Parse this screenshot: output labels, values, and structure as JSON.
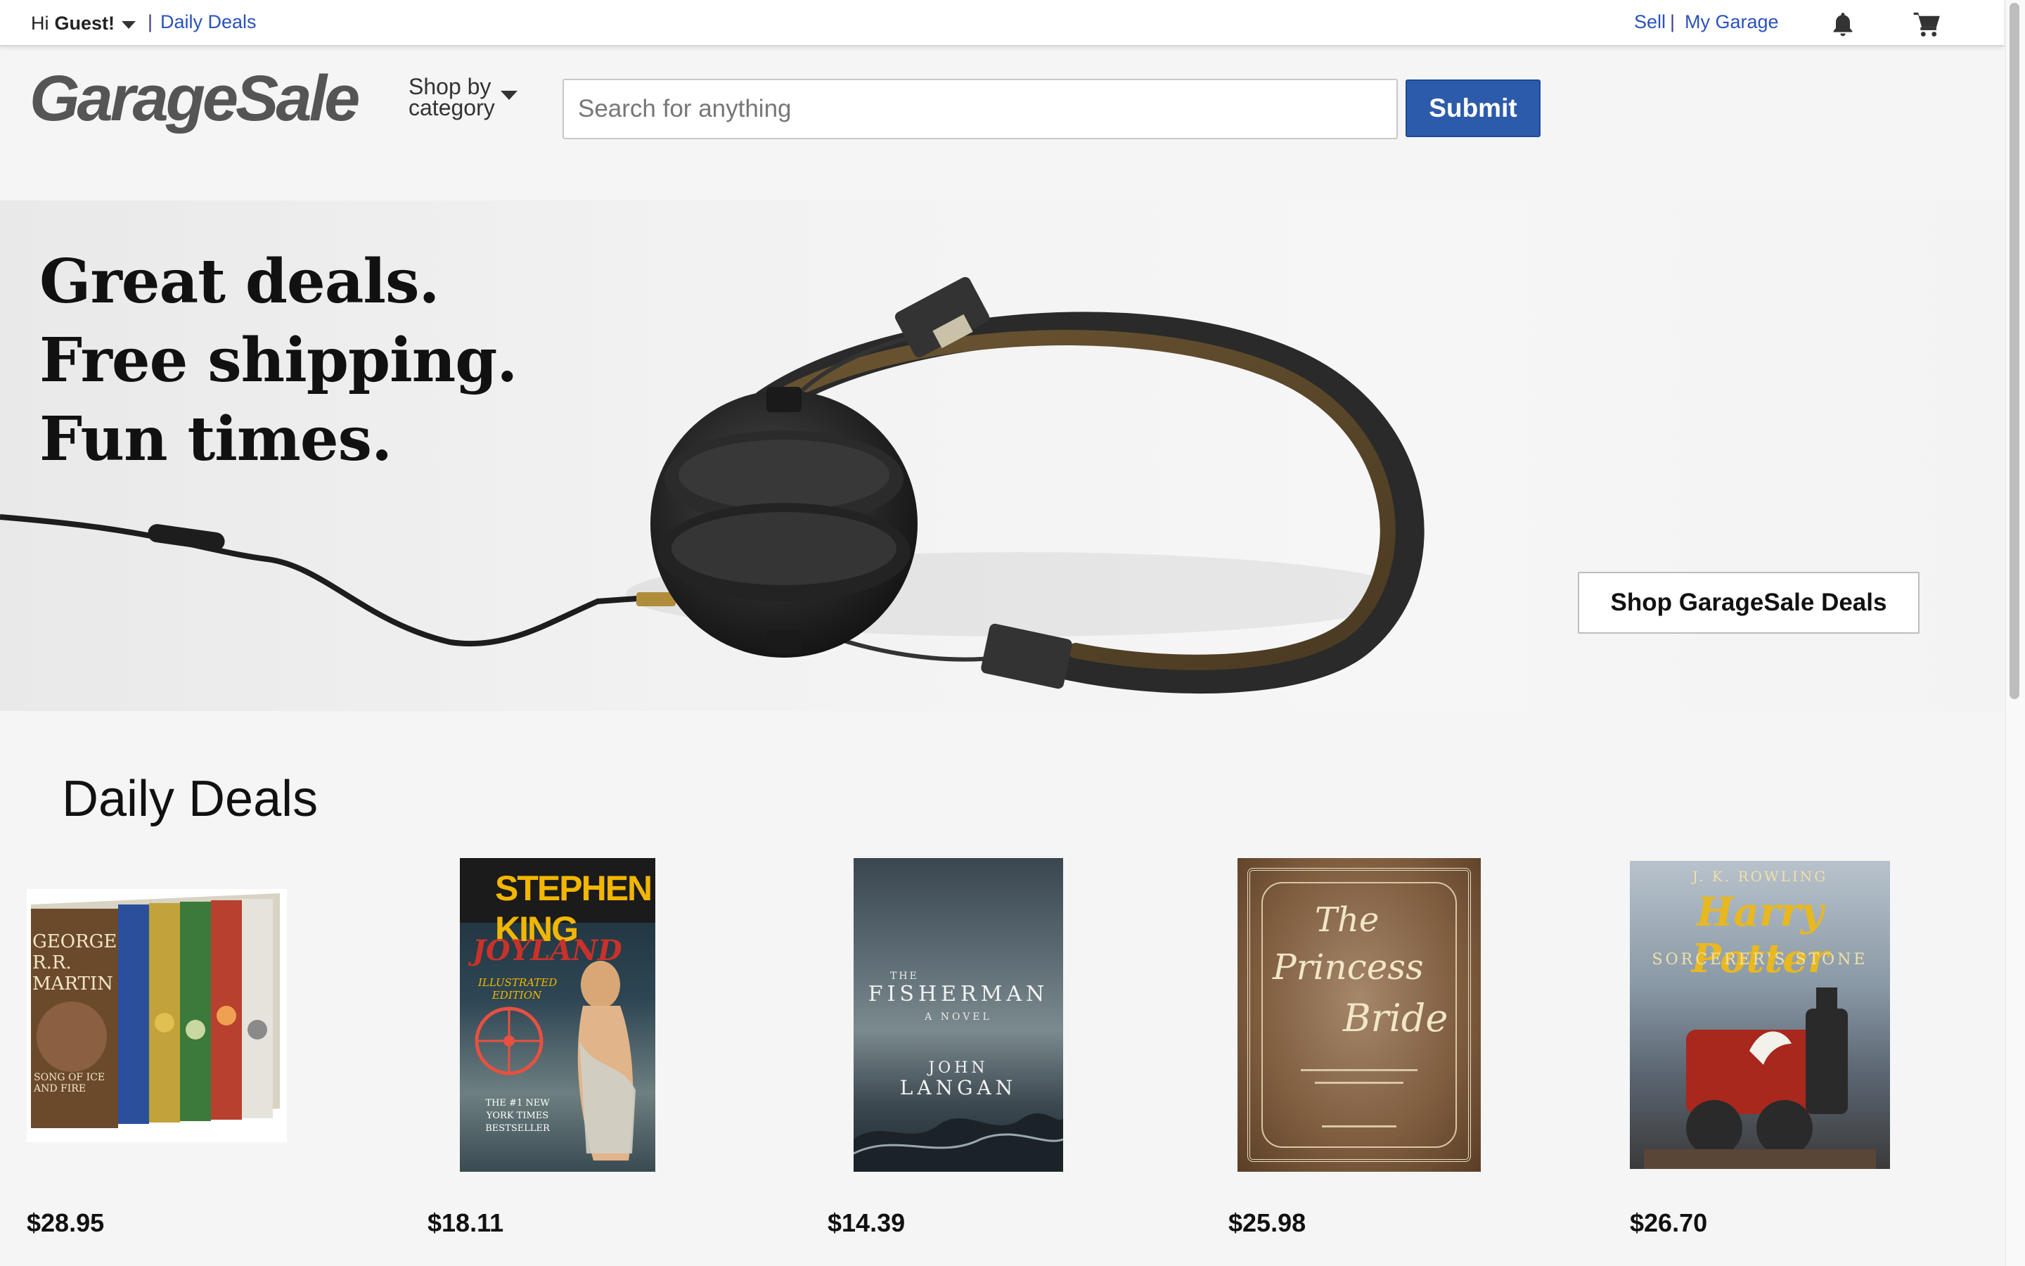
{
  "topbar": {
    "hi": "Hi",
    "guest": "Guest!",
    "separator": "|",
    "daily_deals_link": "Daily Deals",
    "sell_link": "Sell",
    "my_garage_link": "My Garage"
  },
  "header": {
    "logo": "GarageSale",
    "shop_by": "Shop by",
    "category": "category",
    "search_placeholder": "Search for anything",
    "submit_label": "Submit"
  },
  "hero": {
    "line1": "Great deals.",
    "line2": "Free shipping.",
    "line3": "Fun times.",
    "cta_label": "Shop GarageSale Deals"
  },
  "deals": {
    "title": "Daily Deals",
    "items": [
      {
        "price": "$28.95",
        "cover": {
          "author": "GEORGE R.R. MARTIN",
          "subtitle": "SONG OF ICE AND FIRE"
        }
      },
      {
        "price": "$18.11",
        "cover": {
          "author": "STEPHEN KING",
          "title": "JOYLAND",
          "edition": "ILLUSTRATED EDITION",
          "badge": "THE #1 NEW YORK TIMES BESTSELLER"
        }
      },
      {
        "price": "$14.39",
        "cover": {
          "the": "THE",
          "title": "FISHERMAN",
          "sub": "A NOVEL",
          "author1": "JOHN",
          "author2": "LANGAN"
        }
      },
      {
        "price": "$25.98",
        "cover": {
          "the": "The",
          "title1": "Princess",
          "title2": "Bride"
        }
      },
      {
        "price": "$26.70",
        "cover": {
          "author": "J. K. ROWLING",
          "title": "Harry Potter",
          "sub": "SORCERER'S STONE"
        }
      }
    ]
  },
  "colors": {
    "link": "#2a52be",
    "submit_bg": "#2d5bab",
    "logo": "#555555"
  },
  "icons": [
    "caret-down-icon",
    "bell-icon",
    "cart-icon"
  ]
}
